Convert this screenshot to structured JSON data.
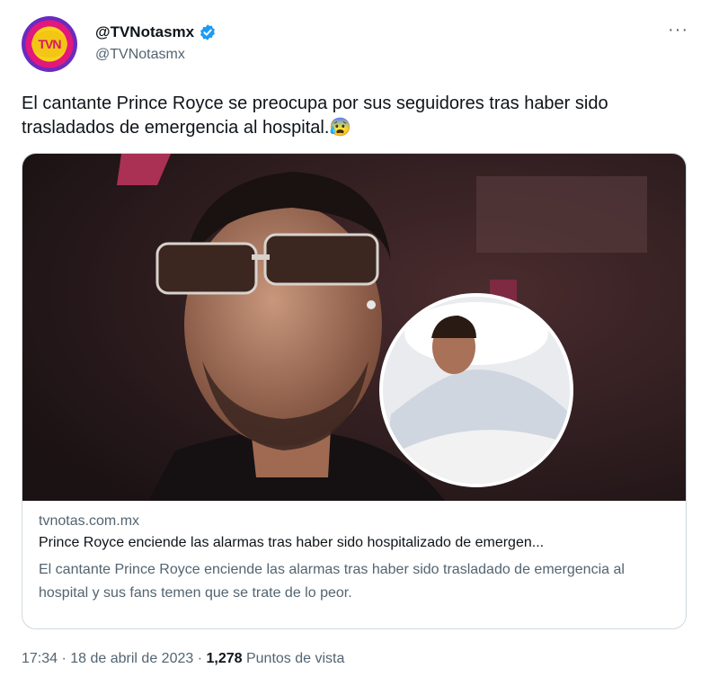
{
  "author": {
    "display_name": "@TVNotasmx",
    "handle": "@TVNotasmx",
    "avatar_text": "TVN",
    "verified": true
  },
  "more_label": "···",
  "tweet": {
    "text": "El cantante Prince Royce se preocupa por sus seguidores tras haber sido trasladados de emergencia al hospital.😰"
  },
  "card": {
    "domain": "tvnotas.com.mx",
    "title": "Prince Royce enciende las alarmas tras haber sido hospitalizado de emergen...",
    "description": "El cantante Prince Royce enciende las alarmas tras haber sido trasladado de emergencia al hospital y sus fans temen que se trate de lo peor."
  },
  "footer": {
    "time": "17:34",
    "sep1": " · ",
    "date": "18 de abril de 2023",
    "sep2": " · ",
    "views": "1,278",
    "views_label": " Puntos de vista"
  },
  "colors": {
    "verified": "#1d9bf0",
    "text": "#0f1419",
    "secondary": "#536471"
  }
}
